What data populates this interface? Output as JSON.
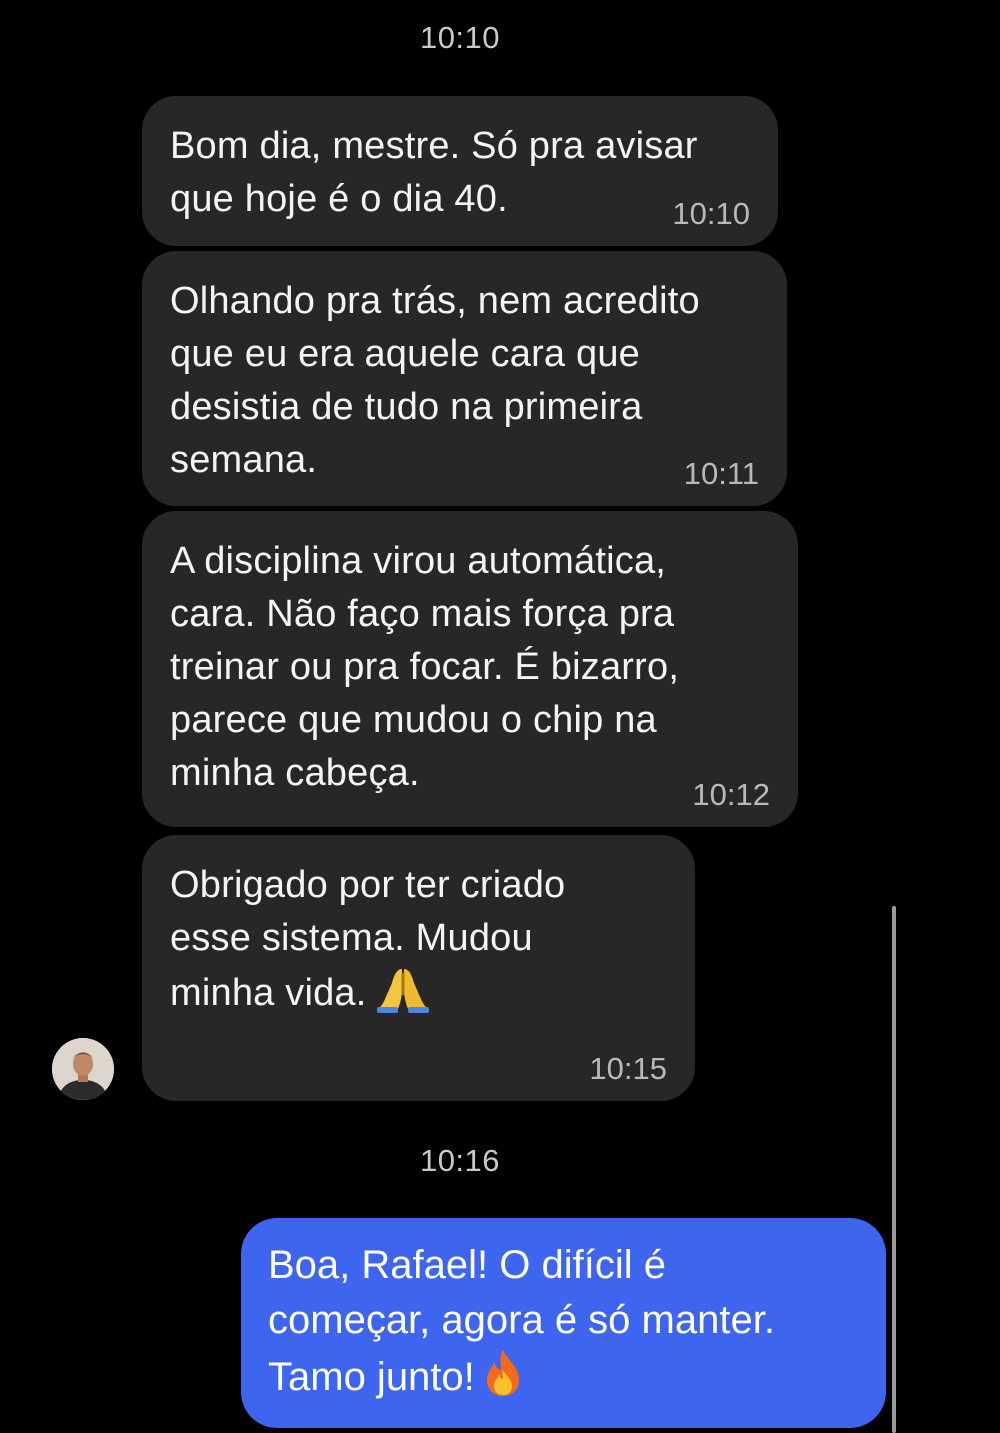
{
  "chat": {
    "top_timestamp": "10:10",
    "incoming": [
      {
        "text": "Bom dia, mestre. Só pra avisar\nque hoje é o dia 40.",
        "time": "10:10"
      },
      {
        "text": "Olhando pra trás, nem acredito\nque eu era aquele cara que\ndesistia de tudo na primeira\nsemana.",
        "time": "10:11"
      },
      {
        "text": "A disciplina virou automática,\ncara. Não faço mais força pra\ntreinar ou pra focar. É bizarro,\nparece que mudou o chip na\nminha cabeça.",
        "time": "10:12"
      },
      {
        "text": "Obrigado por ter criado\nesse sistema. Mudou\nminha vida.",
        "time": "10:15",
        "emoji": "folded-hands"
      }
    ],
    "middle_timestamp": "10:16",
    "outgoing": [
      {
        "text": "Boa, Rafael! O difícil é\ncomeçar, agora é só manter.\nTamo junto!",
        "emoji": "fire"
      }
    ]
  },
  "colors": {
    "background": "#000000",
    "incoming_bubble": "#272727",
    "outgoing_bubble": "#3d65f0",
    "timestamp": "#c9c9c9"
  },
  "icons": {
    "pray_emoji": "folded-hands-emoji",
    "fire_emoji": "fire-emoji",
    "contact_avatar": "avatar"
  }
}
